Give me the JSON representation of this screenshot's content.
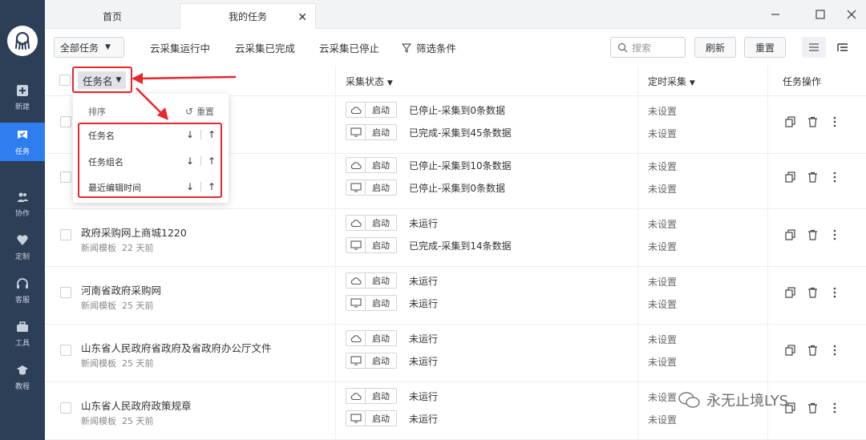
{
  "sidebar": {
    "items": [
      {
        "label": "新建",
        "icon": "plus-square-icon"
      },
      {
        "label": "任务",
        "icon": "flag-icon",
        "active": true
      },
      {
        "label": "协作",
        "icon": "users-icon"
      },
      {
        "label": "定制",
        "icon": "heart-icon"
      },
      {
        "label": "客服",
        "icon": "headset-icon"
      },
      {
        "label": "工具",
        "icon": "toolbox-icon"
      },
      {
        "label": "教程",
        "icon": "mortarboard-icon"
      }
    ]
  },
  "tabs": [
    {
      "label": "首页"
    },
    {
      "label": "我的任务",
      "active": true
    }
  ],
  "toolbar": {
    "all_tasks": "全部任务",
    "filters": [
      "云采集运行中",
      "云采集已完成",
      "云采集已停止"
    ],
    "filter_conditions": "筛选条件",
    "search_placeholder": "搜索",
    "refresh": "刷新",
    "reset": "重置"
  },
  "table": {
    "col_name": "任务名",
    "col_status": "采集状态",
    "col_schedule": "定时采集",
    "col_ops": "任务操作",
    "start_label": "启动",
    "rows": [
      {
        "name": "",
        "meta_template": "",
        "meta_age": "",
        "cloud": "已停止-采集到0条数据",
        "local": "已完成-采集到45条数据",
        "cloud_sched": "未设置",
        "local_sched": "未设置"
      },
      {
        "name": "",
        "meta_template": "",
        "meta_age": "",
        "cloud": "已停止-采集到10条数据",
        "local": "已停止-采集到0条数据",
        "cloud_sched": "未设置",
        "local_sched": "未设置"
      },
      {
        "name": "政府采购网上商城1220",
        "meta_template": "新闻模板",
        "meta_age": "22 天前",
        "cloud": "未运行",
        "local": "已完成-采集到14条数据",
        "cloud_sched": "未设置",
        "local_sched": "未设置"
      },
      {
        "name": "河南省政府采购网",
        "meta_template": "新闻模板",
        "meta_age": "25 天前",
        "cloud": "未运行",
        "local": "未运行",
        "cloud_sched": "未设置",
        "local_sched": "未设置"
      },
      {
        "name": "山东省人民政府省政府及省政府办公厅文件",
        "meta_template": "新闻模板",
        "meta_age": "25 天前",
        "cloud": "未运行",
        "local": "未运行",
        "cloud_sched": "未设置",
        "local_sched": "未设置"
      },
      {
        "name": "山东省人民政府政策规章",
        "meta_template": "新闻模板",
        "meta_age": "25 天前",
        "cloud": "未运行",
        "local": "未运行",
        "cloud_sched": "未设置",
        "local_sched": "未设置"
      }
    ]
  },
  "sort_dropdown": {
    "title": "排序",
    "reset": "重置",
    "items": [
      "任务名",
      "任务组名",
      "最近编辑时间"
    ]
  },
  "watermark": "永无止境LYS",
  "colors": {
    "sidebar": "#2d3e57",
    "active": "#2f7ef0",
    "annotation": "#e6272d"
  }
}
